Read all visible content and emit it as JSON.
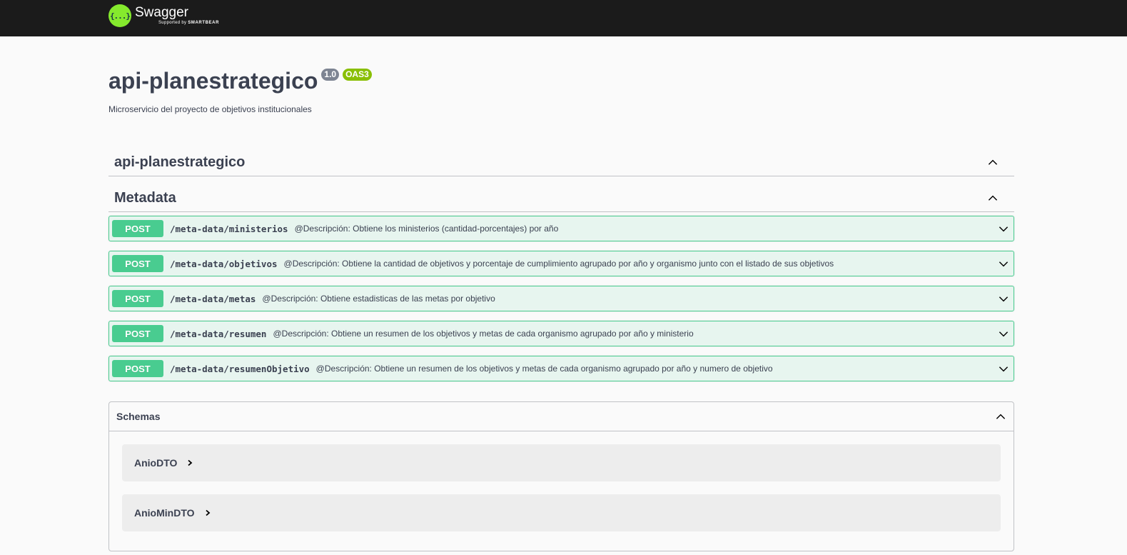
{
  "topbar": {
    "logo_glyph": "{...}",
    "brand_name": "Swagger",
    "brand_sub_prefix": "Supported by",
    "brand_sub_company": "SMARTBEAR",
    "colors": {
      "bar": "#1b1b1b",
      "logo": "#85ea2d"
    }
  },
  "info": {
    "title": "api-planestrategico",
    "version": "1.0",
    "oas": "OAS3",
    "description": "Microservicio del proyecto de objetivos institucionales"
  },
  "tags": [
    {
      "name": "api-planestrategico",
      "icon": "chevron-up-icon"
    },
    {
      "name": "Metadata",
      "icon": "chevron-up-icon"
    }
  ],
  "operations": [
    {
      "method": "POST",
      "path": "/meta-data/ministerios",
      "summary": "@Descripción: Obtiene los ministerios (cantidad-porcentajes) por año"
    },
    {
      "method": "POST",
      "path": "/meta-data/objetivos",
      "summary": "@Descripción: Obtiene la cantidad de objetivos y porcentaje de cumplimiento agrupado por año y organismo junto con el listado de sus objetivos"
    },
    {
      "method": "POST",
      "path": "/meta-data/metas",
      "summary": "@Descripción: Obtiene estadisticas de las metas por objetivo"
    },
    {
      "method": "POST",
      "path": "/meta-data/resumen",
      "summary": "@Descripción: Obtiene un resumen de los objetivos y metas de cada organismo agrupado por año y ministerio"
    },
    {
      "method": "POST",
      "path": "/meta-data/resumenObjetivo",
      "summary": "@Descripción: Obtiene un resumen de los objetivos y metas de cada organismo agrupado por año y numero de objetivo"
    }
  ],
  "schemas": {
    "title": "Schemas",
    "items": [
      "AnioDTO",
      "AnioMinDTO"
    ]
  },
  "colors": {
    "post": "#49cc90",
    "badge_version": "#7d8492",
    "badge_oas": "#89bf04",
    "text": "#3b4151"
  }
}
